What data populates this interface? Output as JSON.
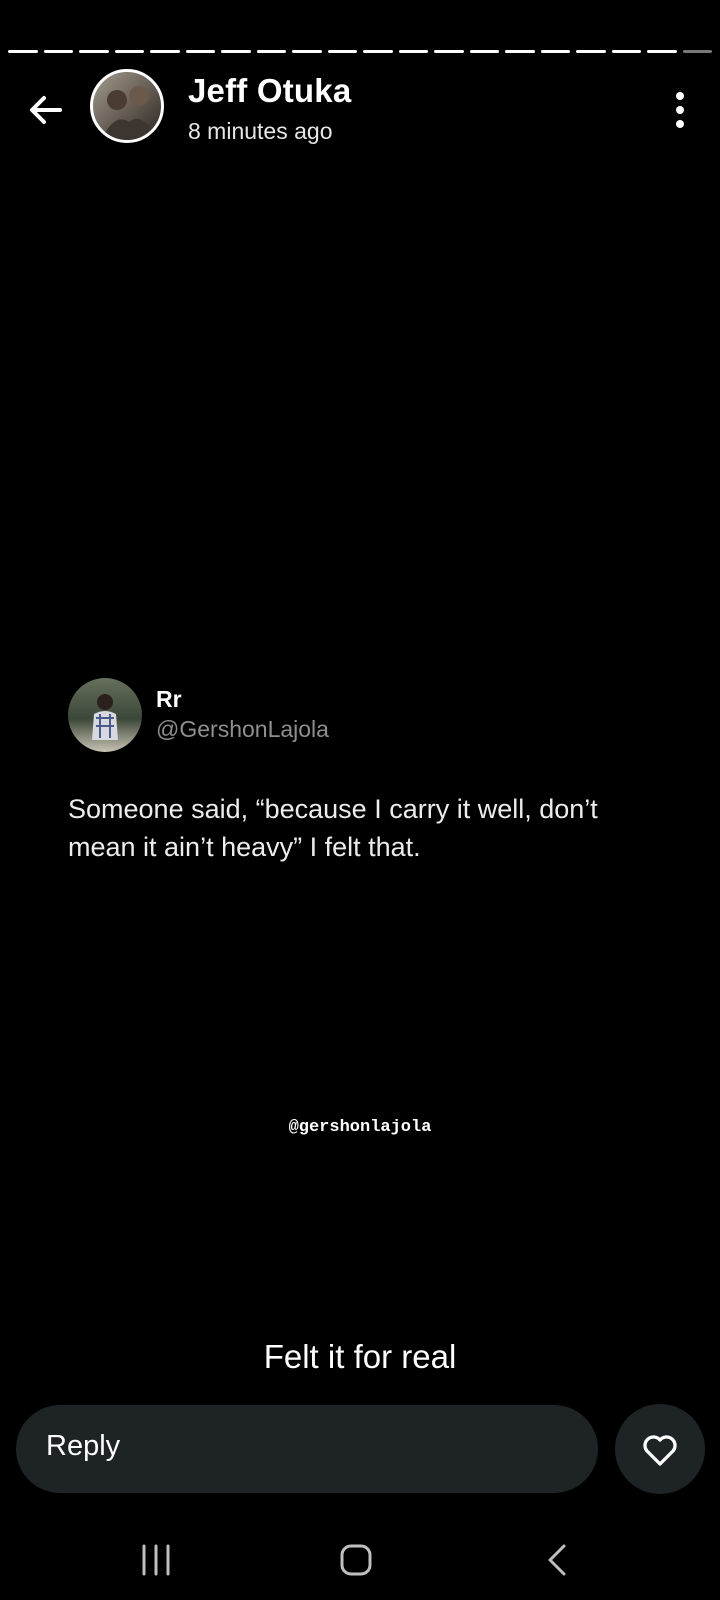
{
  "story": {
    "author_name": "Jeff Otuka",
    "posted_ago": "8 minutes ago",
    "segments_total": 20,
    "segments_viewed": 19
  },
  "tweet": {
    "display_name": "Rr",
    "handle": "@GershonLajola",
    "text": "Someone said, “because I carry it well, don’t mean it ain’t heavy” I felt that."
  },
  "watermark": "@gershonlajola",
  "caption": "Felt it for real",
  "reply": {
    "placeholder": "Reply"
  },
  "icons": {
    "back": "arrow-left-icon",
    "more": "more-vertical-icon",
    "like": "heart-icon",
    "nav_recents": "recents-icon",
    "nav_home": "home-icon",
    "nav_back": "nav-back-icon"
  }
}
